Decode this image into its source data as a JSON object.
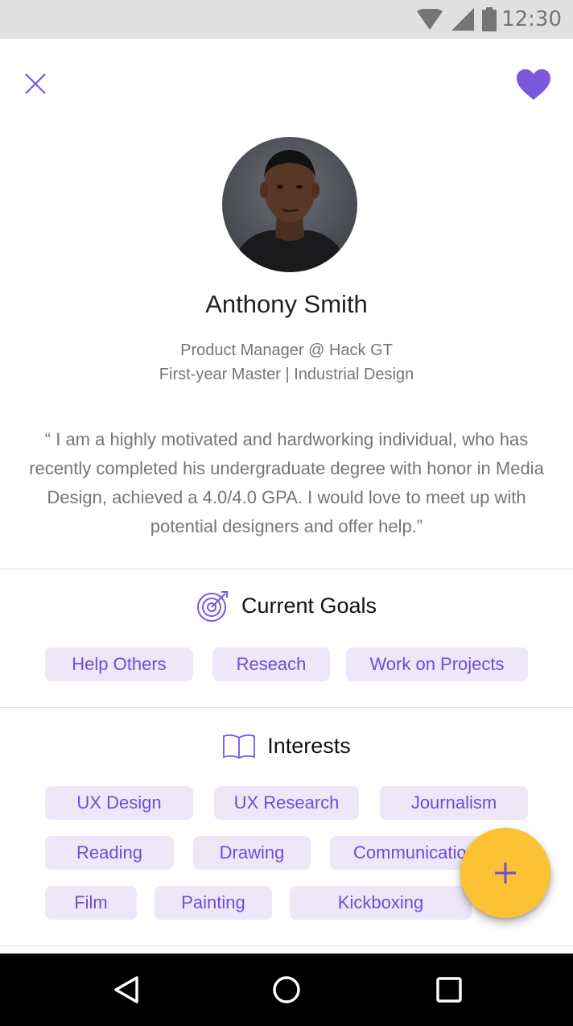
{
  "status_bar": {
    "time": "12:30",
    "icons": [
      "wifi-icon",
      "signal-icon",
      "battery-icon"
    ]
  },
  "header": {
    "close_icon": "close-icon",
    "favorite_icon": "heart-icon"
  },
  "colors": {
    "accent": "#7b57de",
    "chip_bg": "#ede7f8",
    "chip_text": "#6f4cd6",
    "fab": "#fcc233",
    "secondary_text": "#757575"
  },
  "profile": {
    "name": "Anthony Smith",
    "role": "Product Manager @ Hack GT",
    "program": "First-year Master | Industrial Design",
    "quote": "“ I am a highly motivated and hardworking individual, who has recently completed his undergraduate degree with honor in Media Design, achieved a 4.0/4.0 GPA. I would love to meet up with potential designers and offer help.”"
  },
  "goals": {
    "title": "Current Goals",
    "icon": "target-icon",
    "chips": [
      "Help Others",
      "Reseach",
      "Work on Projects"
    ]
  },
  "interests": {
    "title": "Interests",
    "icon": "book-icon",
    "chips": [
      "UX Design",
      "UX Research",
      "Journalism",
      "Reading",
      "Drawing",
      "Communication",
      "Film",
      "Painting",
      "Kickboxing"
    ]
  },
  "fab": {
    "icon": "plus-icon"
  },
  "nav": {
    "icons": [
      "back-icon",
      "home-icon",
      "recents-icon"
    ]
  }
}
